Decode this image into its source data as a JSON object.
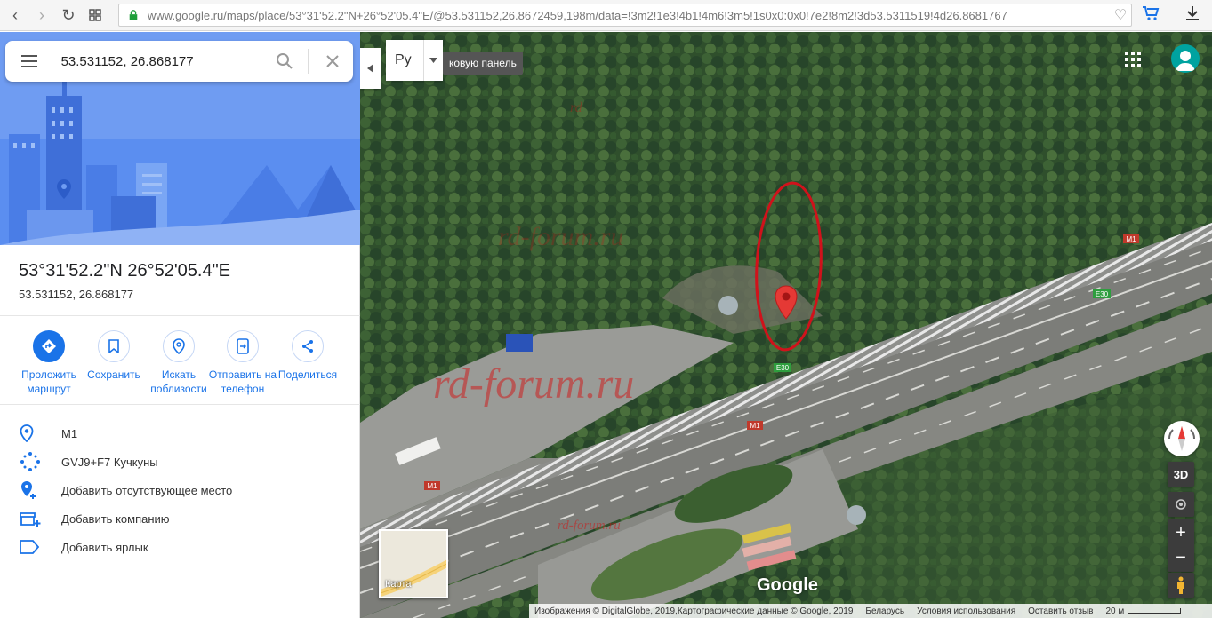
{
  "browser": {
    "url": "www.google.ru/maps/place/53°31'52.2\"N+26°52'05.4\"E/@53.531152,26.8672459,198m/data=!3m2!1e3!4b1!4m6!3m5!1s0x0:0x0!7e2!8m2!3d53.5311519!4d26.8681767"
  },
  "search": {
    "value": "53.531152, 26.868177"
  },
  "place": {
    "title": "53°31'52.2\"N 26°52'05.4\"E",
    "subtitle": "53.531152, 26.868177"
  },
  "actions": [
    {
      "label": "Проложить маршрут"
    },
    {
      "label": "Сохранить"
    },
    {
      "label": "Искать поблизости"
    },
    {
      "label": "Отправить на телефон"
    },
    {
      "label": "Поделиться"
    }
  ],
  "info": [
    {
      "icon": "pin-icon",
      "text": "M1"
    },
    {
      "icon": "plus-code-icon",
      "text": "GVJ9+F7 Кучкуны"
    },
    {
      "icon": "add-place-icon",
      "text": "Добавить отсутствующее место"
    },
    {
      "icon": "add-business-icon",
      "text": "Добавить компанию"
    },
    {
      "icon": "label-icon",
      "text": "Добавить ярлык"
    }
  ],
  "map": {
    "lang_code": "Ру",
    "tooltip": "ковую панель",
    "ctl_3d": "3D",
    "zoom_in": "+",
    "zoom_out": "−",
    "minimap_label": "Карта",
    "google": "Google",
    "road_labels": {
      "m1": "M1",
      "e30": "E30"
    },
    "watermark": "rd-forum.ru",
    "watermark_small": "rd",
    "footer": {
      "imagery": "Изображения © DigitalGlobe, 2019,Картографические данные © Google, 2019",
      "country": "Беларусь",
      "terms": "Условия использования",
      "feedback": "Оставить отзыв",
      "scale": "20 м"
    }
  },
  "colors": {
    "accent": "#1a73e8",
    "hero": "#5b8ef0",
    "marker": "#e53935",
    "annotation": "#d0121b"
  }
}
